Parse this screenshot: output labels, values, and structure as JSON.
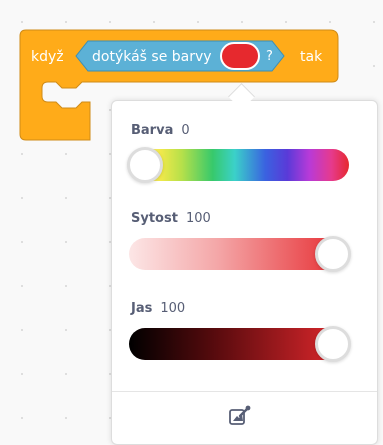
{
  "block": {
    "when_keyword": "když",
    "reporter_label": "dotýkáš se barvy",
    "question_mark": "?",
    "then_keyword": "tak",
    "block_color": "#ffab19",
    "reporter_color": "#5cb1d6",
    "selected_color": "#e6292e"
  },
  "color_picker": {
    "hue": {
      "label": "Barva",
      "value": "0",
      "fraction": 0.0
    },
    "saturation": {
      "label": "Sytost",
      "value": "100",
      "fraction": 1.0
    },
    "brightness": {
      "label": "Jas",
      "value": "100",
      "fraction": 1.0
    },
    "eyedropper_icon": "eyedropper-icon"
  }
}
